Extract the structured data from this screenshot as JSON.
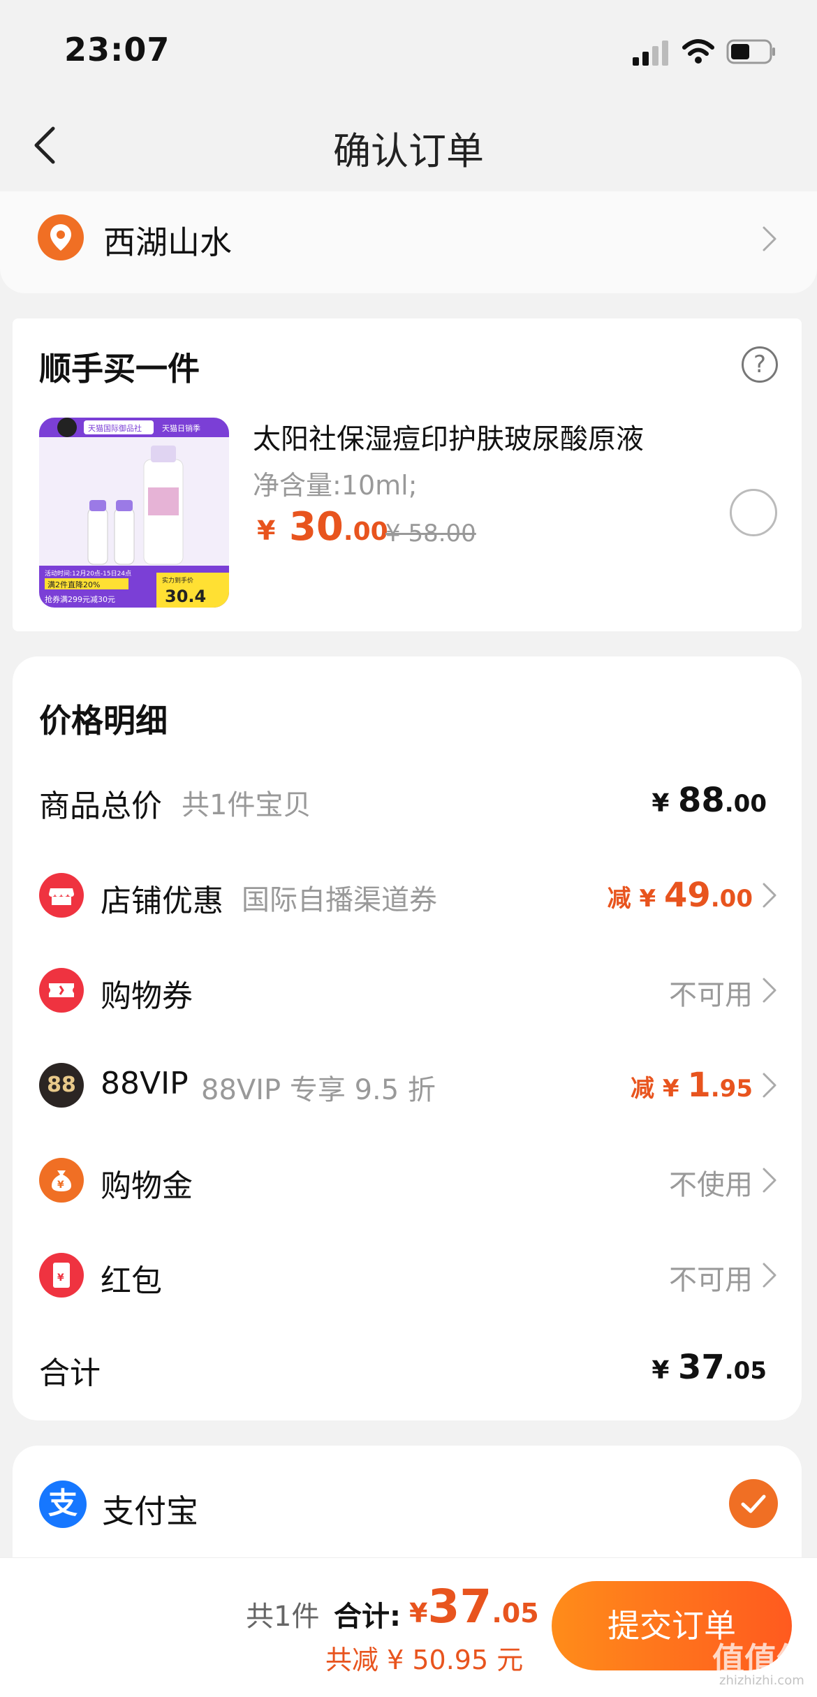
{
  "status_bar": {
    "time": "23:07"
  },
  "nav": {
    "title": "确认订单"
  },
  "address": {
    "text": "西湖山水"
  },
  "extra_item": {
    "section_title": "顺手买一件",
    "help_icon": "?",
    "product_name": "太阳社保湿痘印护肤玻尿酸原液",
    "spec": "净含量:10ml;",
    "price_symbol": "¥",
    "price_int": "30",
    "price_dec": ".00",
    "old_price": "¥ 58.00",
    "image_texts": {
      "badge_top": "天猫国际御品社",
      "badge_top2": "天猫日销季",
      "promo1": "活动时间:12月20点-15日24点",
      "promo2": "满2件直降20%",
      "promo3": "抢券满299元减30元",
      "promo_right": "实力到手价",
      "promo_price": "30.4"
    }
  },
  "price_details": {
    "title": "价格明细",
    "rows": [
      {
        "label": "商品总价",
        "sub": "共1件宝贝",
        "value_prefix": "¥ ",
        "value_int": "88",
        "value_dec": ".00"
      },
      {
        "label": "店铺优惠",
        "sub": "国际自播渠道券",
        "value_prefix": "减 ¥ ",
        "value_int": "49",
        "value_dec": ".00"
      },
      {
        "label": "购物券",
        "sub": "",
        "value": "不可用"
      },
      {
        "label": "88VIP",
        "sub": "88VIP 专享 9.5 折",
        "value_prefix": "减 ¥ ",
        "value_int": "1",
        "value_dec": ".95",
        "icon_text": "88"
      },
      {
        "label": "购物金",
        "sub": "",
        "value": "不使用"
      },
      {
        "label": "红包",
        "sub": "",
        "value": "不可用"
      }
    ],
    "total": {
      "label": "合计",
      "value_prefix": "¥ ",
      "value_int": "37",
      "value_dec": ".05"
    }
  },
  "payment": {
    "alipay_label": "支付宝",
    "alipay_icon_text": "支"
  },
  "bottom": {
    "count_text": "共1件",
    "total_label": "合计:",
    "total_symbol": "¥",
    "total_int": "37",
    "total_dec": ".05",
    "saved": "共减 ¥ 50.95 元",
    "submit_label": "提交订单",
    "watermark": "值值值",
    "watermark_sub": "zhizhizhi.com"
  },
  "colors": {
    "accent": "#e8541e",
    "orange": "#f06f24",
    "alipay": "#1677ff"
  }
}
